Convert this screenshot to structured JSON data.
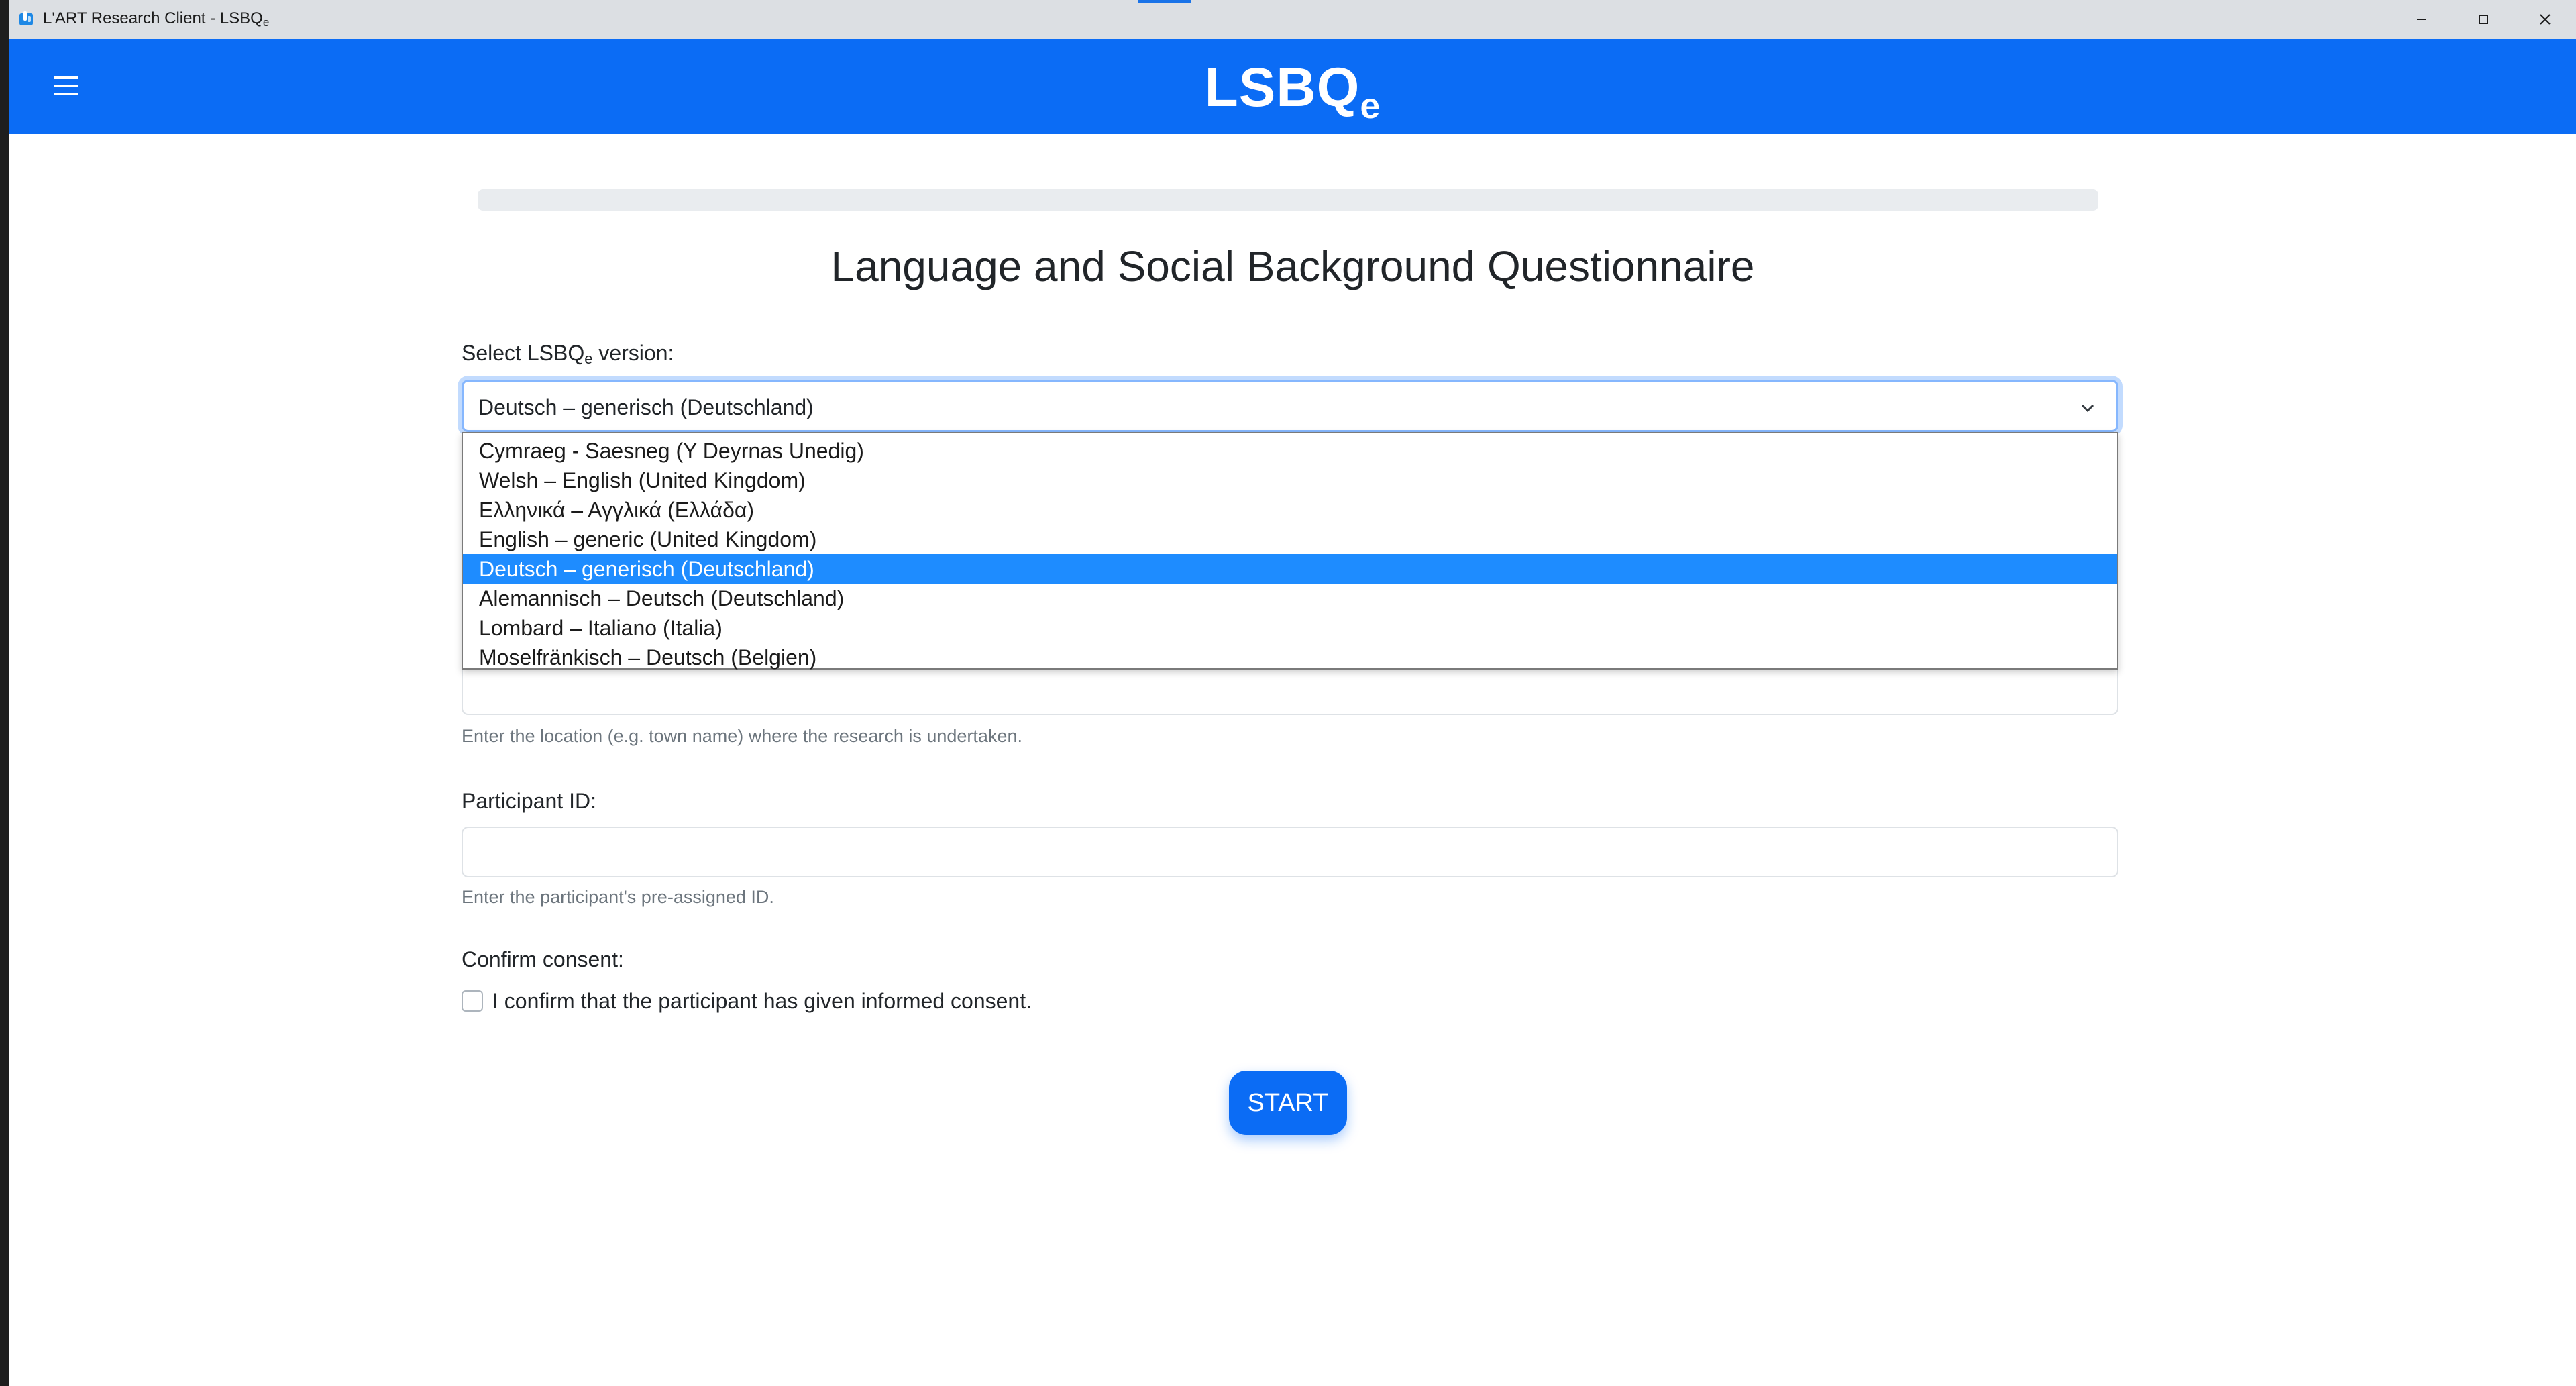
{
  "window": {
    "title": "L'ART Research Client - LSBQ",
    "title_sub": "e",
    "controls": [
      "minimize-icon",
      "maximize-icon",
      "close-icon"
    ]
  },
  "appbar": {
    "menu_icon": "hamburger-icon",
    "brand": "LSBQ",
    "brand_sub": "e",
    "color": "#0b6cf5"
  },
  "main": {
    "title": "Language and Social Background Questionnaire",
    "version_label": "Select LSBQ",
    "version_label_sub": "e",
    "version_label_suffix": " version:",
    "selected_version": "Deutsch – generisch (Deutschland)",
    "options": [
      "Cymraeg - Saesneg (Y Deyrnas Unedig)",
      "Welsh – English (United Kingdom)",
      "Ελληνικά – Αγγλικά (Ελλάδα)",
      "English – generic (United Kingdom)",
      "Deutsch – generisch (Deutschland)",
      "Alemannisch – Deutsch (Deutschland)",
      "Lombard – Italiano (Italia)",
      "Moselfränkisch – Deutsch (Belgien)"
    ],
    "selected_index": 4,
    "location_help": "Enter the location (e.g. town name) where the research is undertaken.",
    "participant_label": "Participant ID:",
    "participant_value": "",
    "participant_help": "Enter the participant's pre-assigned ID.",
    "consent_label": "Confirm consent:",
    "consent_text": "I confirm that the participant has given informed consent.",
    "consent_checked": false,
    "start_label": "START"
  }
}
